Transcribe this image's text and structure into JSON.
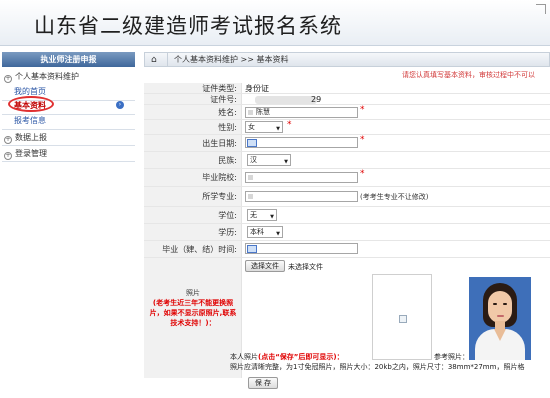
{
  "header": {
    "title": "山东省二级建造师考试报名系统"
  },
  "sidebar": {
    "heading": "执业师注册申报",
    "groups": [
      {
        "label": "个人基本资料维护",
        "expander": "+"
      },
      {
        "label": "数据上报",
        "expander": "+"
      },
      {
        "label": "登录管理",
        "expander": "+"
      }
    ],
    "items": [
      {
        "label": "我的首页"
      },
      {
        "label": "基本资料"
      },
      {
        "label": "报考信息"
      }
    ],
    "active_arrow": "›"
  },
  "breadcrumb": {
    "home_icon": "⌂",
    "path": "个人基本资料维护 >> 基本资料"
  },
  "notice": "请您认真填写基本资料，审核过程中不可以",
  "form": {
    "id_type": {
      "label": "证件类型:",
      "value": "身份证"
    },
    "id_number": {
      "label": "证件号:",
      "value_suffix": "29"
    },
    "name": {
      "label": "姓名:",
      "value": "陈慧",
      "required": "*"
    },
    "gender": {
      "label": "性别:",
      "value": "女",
      "required": "*"
    },
    "birth": {
      "label": "出生日期:",
      "required": "*"
    },
    "ethnicity": {
      "label": "民族:",
      "value": "汉"
    },
    "school": {
      "label": "毕业院校:",
      "required": "*"
    },
    "major": {
      "label": "所学专业:",
      "note": "(考考生专业不让修改)"
    },
    "degree": {
      "label": "学位:",
      "value": "无"
    },
    "education": {
      "label": "学历:",
      "value": "本科"
    },
    "grad_time": {
      "label": "毕业（肄、结）时间:"
    },
    "photo": {
      "label": "照片",
      "warning": "(老考生近三年不能更换照片，如果不显示原照片,联系技术支持！)：",
      "choose_button": "选择文件",
      "no_file": "未选择文件",
      "self_caption": "本人照片",
      "self_caption_hint": "(点击“保存”后即可显示)：",
      "ref_caption": "参考照片：",
      "requirements": "照片应清晰完整，为1寸免冠照片，照片大小：20kb之内，照片尺寸：38mm*27mm，照片格"
    },
    "save_button": "保 存"
  }
}
